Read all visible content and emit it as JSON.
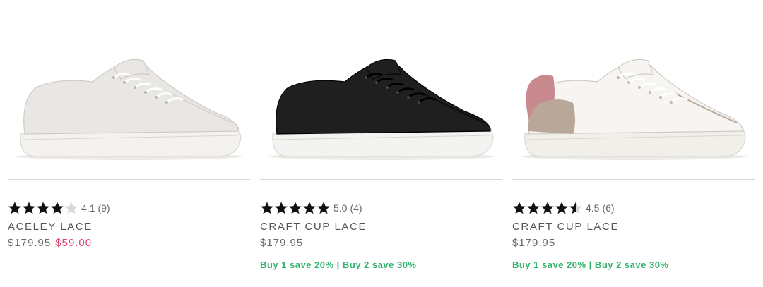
{
  "products": [
    {
      "name": "ACELEY LACE",
      "rating": 4.1,
      "rating_label": "4.1",
      "review_count": "(9)",
      "price_original": "$179.95",
      "price_sale": "$59.00",
      "promo": "",
      "colors": {
        "upper": "#e9e7e3",
        "sole": "#f4f2ee",
        "accent": "#d8d5cf"
      }
    },
    {
      "name": "CRAFT CUP LACE",
      "rating": 5.0,
      "rating_label": "5.0",
      "review_count": "(4)",
      "price_original": "$179.95",
      "price_sale": "",
      "promo": "Buy 1 save 20% | Buy 2 save 30%",
      "colors": {
        "upper": "#1f1f1f",
        "sole": "#f3f3f1",
        "accent": "#0d0d0d"
      }
    },
    {
      "name": "CRAFT CUP LACE",
      "rating": 4.5,
      "rating_label": "4.5",
      "review_count": "(6)",
      "price_original": "$179.95",
      "price_sale": "",
      "promo": "Buy 1 save 20% | Buy 2 save 30%",
      "colors": {
        "upper": "#f6f5f2",
        "sole": "#f1efea",
        "accent": "#b9a89a",
        "collar": "#c98a8f"
      }
    }
  ],
  "theme": {
    "sale_color": "#e03e6a",
    "promo_color": "#2fb36a",
    "star_color": "#111111",
    "star_empty": "#d8d8d8"
  }
}
